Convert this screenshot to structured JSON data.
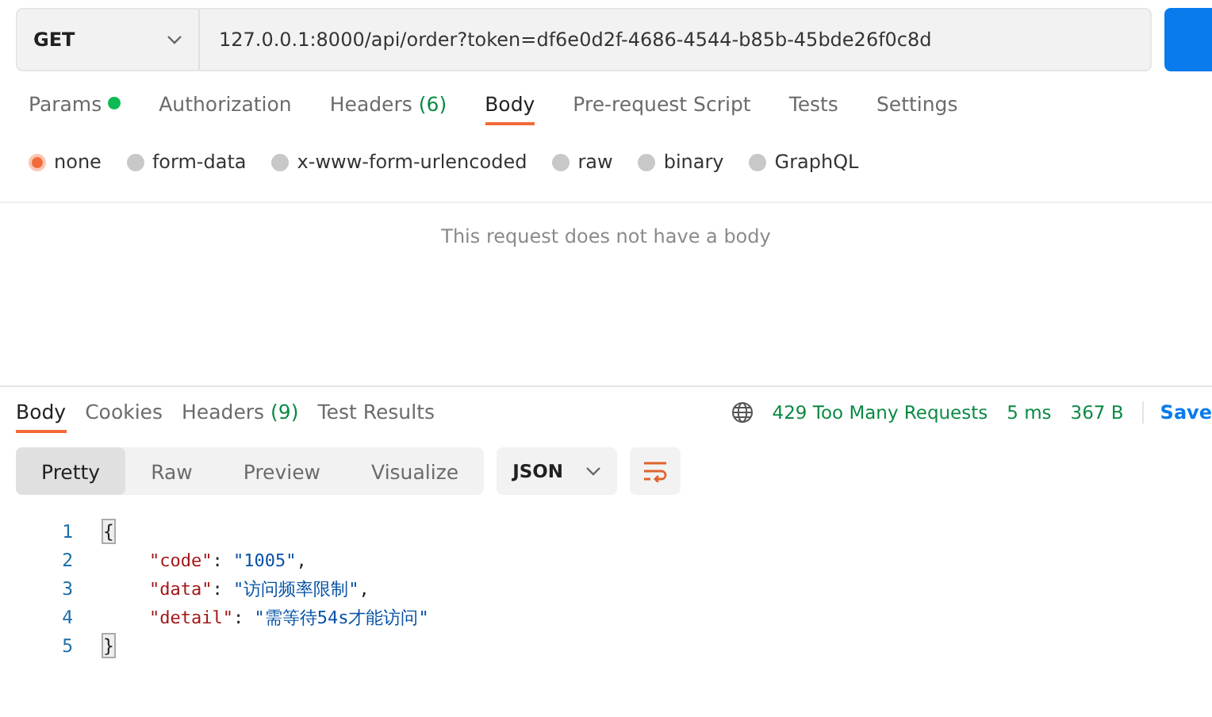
{
  "request": {
    "method": "GET",
    "url": "127.0.0.1:8000/api/order?token=df6e0d2f-4686-4544-b85b-45bde26f0c8d"
  },
  "request_tabs": [
    {
      "label": "Params",
      "dot": true,
      "selected": false
    },
    {
      "label": "Authorization",
      "dot": false,
      "selected": false
    },
    {
      "label": "Headers",
      "count": "(6)",
      "dot": false,
      "selected": false
    },
    {
      "label": "Body",
      "dot": false,
      "selected": true
    },
    {
      "label": "Pre-request Script",
      "dot": false,
      "selected": false
    },
    {
      "label": "Tests",
      "dot": false,
      "selected": false
    },
    {
      "label": "Settings",
      "dot": false,
      "selected": false
    }
  ],
  "body_types": [
    {
      "label": "none",
      "selected": true
    },
    {
      "label": "form-data",
      "selected": false
    },
    {
      "label": "x-www-form-urlencoded",
      "selected": false
    },
    {
      "label": "raw",
      "selected": false
    },
    {
      "label": "binary",
      "selected": false
    },
    {
      "label": "GraphQL",
      "selected": false
    }
  ],
  "empty_body_message": "This request does not have a body",
  "response_tabs": [
    {
      "label": "Body",
      "selected": true
    },
    {
      "label": "Cookies",
      "selected": false
    },
    {
      "label": "Headers",
      "count": "(9)",
      "selected": false
    },
    {
      "label": "Test Results",
      "selected": false
    }
  ],
  "response_status": {
    "status": "429 Too Many Requests",
    "time": "5 ms",
    "size": "367 B",
    "save": "Save"
  },
  "view_modes": [
    {
      "label": "Pretty",
      "selected": true
    },
    {
      "label": "Raw",
      "selected": false
    },
    {
      "label": "Preview",
      "selected": false
    },
    {
      "label": "Visualize",
      "selected": false
    }
  ],
  "format": "JSON",
  "code_lines": [
    {
      "number": "1",
      "kind": "brace",
      "text": "{"
    },
    {
      "number": "2",
      "kind": "pair",
      "key": "\"code\"",
      "colon": ": ",
      "value": "\"1005\"",
      "comma": ","
    },
    {
      "number": "3",
      "kind": "pair",
      "key": "\"data\"",
      "colon": ": ",
      "value": "\"访问频率限制\"",
      "comma": ","
    },
    {
      "number": "4",
      "kind": "pair",
      "key": "\"detail\"",
      "colon": ": ",
      "value": "\"需等待54s才能访问\""
    },
    {
      "number": "5",
      "kind": "brace",
      "text": "}"
    }
  ]
}
